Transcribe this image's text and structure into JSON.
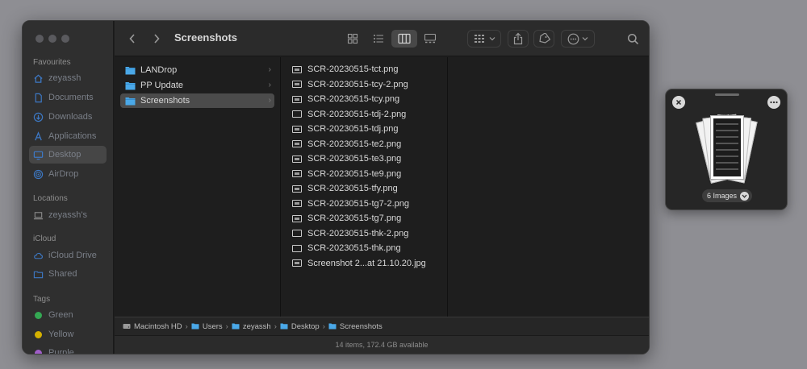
{
  "window": {
    "title": "Screenshots"
  },
  "sidebar": {
    "sections": [
      {
        "label": "Favourites",
        "items": [
          {
            "label": "zeyassh",
            "icon": "home-icon"
          },
          {
            "label": "Documents",
            "icon": "document-icon"
          },
          {
            "label": "Downloads",
            "icon": "download-icon"
          },
          {
            "label": "Applications",
            "icon": "applications-icon"
          },
          {
            "label": "Desktop",
            "icon": "desktop-icon",
            "selected": true
          },
          {
            "label": "AirDrop",
            "icon": "airdrop-icon"
          }
        ]
      },
      {
        "label": "Locations",
        "items": [
          {
            "label": "zeyassh's",
            "icon": "laptop-icon"
          }
        ]
      },
      {
        "label": "iCloud",
        "items": [
          {
            "label": "iCloud Drive",
            "icon": "cloud-icon"
          },
          {
            "label": "Shared",
            "icon": "shared-folder-icon"
          }
        ]
      },
      {
        "label": "Tags",
        "items": [
          {
            "label": "Green",
            "color": "#34a853"
          },
          {
            "label": "Yellow",
            "color": "#d4b000"
          },
          {
            "label": "Purple",
            "color": "#a05ec8"
          }
        ]
      }
    ]
  },
  "column1": [
    {
      "name": "LANDrop"
    },
    {
      "name": "PP Update"
    },
    {
      "name": "Screenshots",
      "selected": true
    }
  ],
  "column2": [
    {
      "name": "SCR-20230515-tct.png"
    },
    {
      "name": "SCR-20230515-tcy-2.png"
    },
    {
      "name": "SCR-20230515-tcy.png"
    },
    {
      "name": "SCR-20230515-tdj-2.png",
      "hollow": true
    },
    {
      "name": "SCR-20230515-tdj.png"
    },
    {
      "name": "SCR-20230515-te2.png"
    },
    {
      "name": "SCR-20230515-te3.png"
    },
    {
      "name": "SCR-20230515-te9.png"
    },
    {
      "name": "SCR-20230515-tfy.png"
    },
    {
      "name": "SCR-20230515-tg7-2.png"
    },
    {
      "name": "SCR-20230515-tg7.png"
    },
    {
      "name": "SCR-20230515-thk-2.png",
      "hollow": true
    },
    {
      "name": "SCR-20230515-thk.png",
      "hollow": true
    },
    {
      "name": "Screenshot 2...at 21.10.20.jpg"
    }
  ],
  "pathbar": [
    "Macintosh HD",
    "Users",
    "zeyassh",
    "Desktop",
    "Screenshots"
  ],
  "status": "14 items, 172.4 GB available",
  "preview": {
    "label": "6 Images"
  },
  "colors": {
    "folder": "#4aa8e8",
    "accent_selected": "#4b4b4b"
  }
}
